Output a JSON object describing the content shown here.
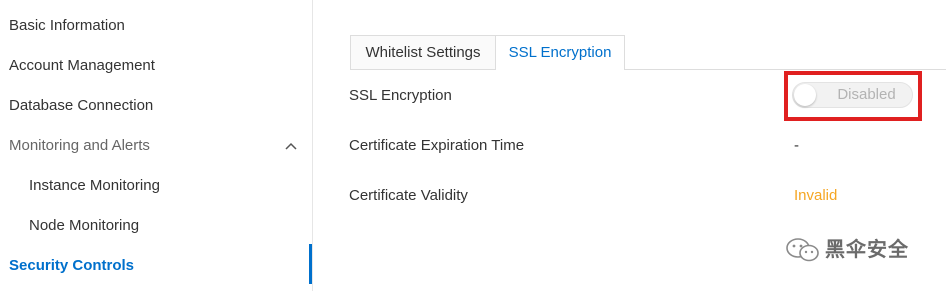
{
  "sidebar": {
    "items": [
      {
        "label": "Basic Information"
      },
      {
        "label": "Account Management"
      },
      {
        "label": "Database Connection"
      },
      {
        "label": "Monitoring and Alerts",
        "expanded": true,
        "icon": "chevron-up-icon"
      },
      {
        "label": "Instance Monitoring"
      },
      {
        "label": "Node Monitoring"
      },
      {
        "label": "Security Controls",
        "active": true
      }
    ]
  },
  "tabs": [
    {
      "label": "Whitelist Settings"
    },
    {
      "label": "SSL Encryption",
      "active": true
    }
  ],
  "ssl": {
    "encryption_label": "SSL Encryption",
    "toggle_text": "Disabled",
    "toggle_on": false,
    "expiration_label": "Certificate Expiration Time",
    "expiration_value": "-",
    "validity_label": "Certificate Validity",
    "validity_value": "Invalid"
  },
  "watermark": {
    "text": "黑伞安全",
    "icon": "wechat-icon"
  },
  "colors": {
    "accent": "#0070cc",
    "warning": "#f5a623",
    "highlight": "#e02020",
    "text": "#333333"
  }
}
